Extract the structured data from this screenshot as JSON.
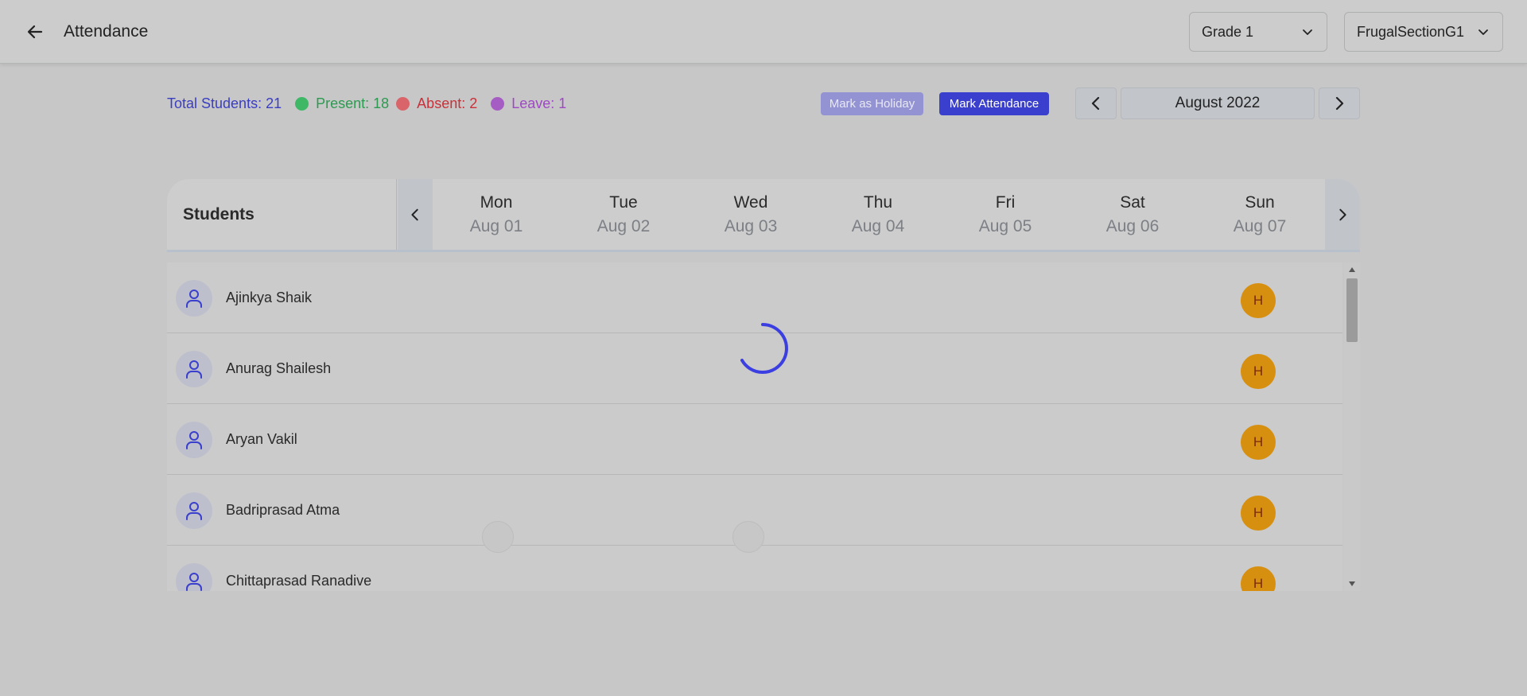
{
  "header": {
    "title": "Attendance",
    "grade_select": "Grade 1",
    "section_select": "FrugalSectionG1"
  },
  "summary": {
    "total": "Total Students: 21",
    "present": "Present: 18",
    "absent": "Absent: 2",
    "leave": "Leave: 1"
  },
  "actions": {
    "mark_holiday": "Mark as Holiday",
    "mark_attendance": "Mark Attendance"
  },
  "month_nav": {
    "label": "August 2022"
  },
  "table": {
    "students_header": "Students",
    "days": [
      {
        "name": "Mon",
        "date": "Aug 01"
      },
      {
        "name": "Tue",
        "date": "Aug 02"
      },
      {
        "name": "Wed",
        "date": "Aug 03"
      },
      {
        "name": "Thu",
        "date": "Aug 04"
      },
      {
        "name": "Fri",
        "date": "Aug 05"
      },
      {
        "name": "Sat",
        "date": "Aug 06"
      },
      {
        "name": "Sun",
        "date": "Aug 07"
      }
    ],
    "rows": [
      {
        "name": "Ajinkya Shaik",
        "sun_status": "H"
      },
      {
        "name": "Anurag Shailesh",
        "sun_status": "H"
      },
      {
        "name": "Aryan Vakil",
        "sun_status": "H"
      },
      {
        "name": "Badriprasad Atma",
        "sun_status": "H"
      },
      {
        "name": "Chittaprasad Ranadive",
        "sun_status": "H"
      }
    ]
  },
  "colors": {
    "accent": "#3a3fcd",
    "present": "#3fb866",
    "absent": "#d9646a",
    "leave": "#a55dc4",
    "holiday": "#d78f10"
  },
  "icons": {
    "back": "arrow-left-icon",
    "dropdown": "chevron-down-icon",
    "prev": "chevron-left-icon",
    "next": "chevron-right-icon",
    "avatar": "user-icon",
    "loading": "spinner-icon"
  }
}
